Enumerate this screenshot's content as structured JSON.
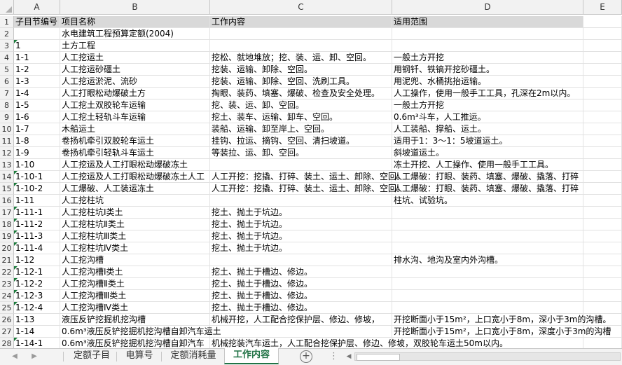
{
  "columns": [
    "A",
    "B",
    "C",
    "D",
    "E"
  ],
  "rows": [
    {
      "n": "1",
      "a": "子目节编号",
      "b": "项目名称",
      "c": "工作内容",
      "d": "适用范围",
      "header": true
    },
    {
      "n": "2",
      "a": "",
      "b": "水电建筑工程预算定额(2004)",
      "c": "",
      "d": ""
    },
    {
      "n": "3",
      "a": "1",
      "b": "土方工程",
      "c": "",
      "d": "",
      "ta": true
    },
    {
      "n": "4",
      "a": "1-1",
      "b": "人工挖运土",
      "c": "挖松、就地堆放；挖、装、运、卸、空回。",
      "d": "一般土方开挖"
    },
    {
      "n": "5",
      "a": "1-2",
      "b": "人工挖运砂礓土",
      "c": "挖装、运输、卸除、空回。",
      "d": "用钢钎、铁镐开挖砂礓土。"
    },
    {
      "n": "6",
      "a": "1-3",
      "b": "人工挖运淤泥、流砂",
      "c": "挖装、运输、卸除、空回、洗刷工具。",
      "d": "用泥兜、水桶挑抬运输。"
    },
    {
      "n": "7",
      "a": "1-4",
      "b": "人工打眼松动爆破土方",
      "c": "掏眼、装药、填塞、爆破、检查及安全处理。",
      "d": "人工操作，使用一般手工工具，孔深在2m以内。"
    },
    {
      "n": "8",
      "a": "1-5",
      "b": "人工挖土双胶轮车运输",
      "c": "挖、装、运、卸、空回。",
      "d": "一般土方开挖"
    },
    {
      "n": "9",
      "a": "1-6",
      "b": "人工挖土轻轨斗车运输",
      "c": "挖土、装车、运输、卸车、空回。",
      "d": "0.6m³斗车，人工推运。"
    },
    {
      "n": "10",
      "a": "1-7",
      "b": "木船运土",
      "c": "装船、运输、卸至岸上、空回。",
      "d": "人工装船、撑船、运土。"
    },
    {
      "n": "11",
      "a": "1-8",
      "b": "卷扬机牵引双胶轮车运土",
      "c": "挂钩、拉运、摘钩、空回、清扫坡道。",
      "d": "适用于1：3～1：5坡道运土。"
    },
    {
      "n": "12",
      "a": "1-9",
      "b": "卷扬机牵引轻轨斗车运土",
      "c": "等装拉、运、卸、空回。",
      "d": "斜坡道运土。"
    },
    {
      "n": "13",
      "a": "1-10",
      "b": "人工挖运及人工打眼松动爆破冻土",
      "c": "",
      "d": "冻土开挖、人工操作、使用一般手工工具。",
      "spillD": true
    },
    {
      "n": "14",
      "a": "1-10-1",
      "b": "人工挖运及人工打眼松动爆破冻土人工",
      "c": "人工开挖：挖撬、打碎、装土、运土、卸除、空回。",
      "d": "人工爆破：打眼、装药、填塞、爆破、撬落、打碎",
      "ta": true,
      "spillC": true,
      "spillD": true
    },
    {
      "n": "15",
      "a": "1-10-2",
      "b": "人工爆破、人工装运冻土",
      "c": "人工开挖：挖撬、打碎、装土、运土、卸除、空回。",
      "d": "人工爆破：打眼、装药、填塞、爆破、撬落、打碎",
      "ta": true,
      "spillC": true,
      "spillD": true
    },
    {
      "n": "16",
      "a": "1-11",
      "b": "人工挖柱坑",
      "c": "",
      "d": "柱坑、试验坑。"
    },
    {
      "n": "17",
      "a": "1-11-1",
      "b": "人工挖柱坑Ⅰ类土",
      "c": "挖土、抛土于坑边。",
      "d": "",
      "ta": true
    },
    {
      "n": "18",
      "a": "1-11-2",
      "b": "人工挖柱坑Ⅱ类土",
      "c": "挖土、抛土于坑边。",
      "d": "",
      "ta": true
    },
    {
      "n": "19",
      "a": "1-11-3",
      "b": "人工挖柱坑Ⅲ类土",
      "c": "挖土、抛土于坑边。",
      "d": "",
      "ta": true
    },
    {
      "n": "20",
      "a": "1-11-4",
      "b": "人工挖柱坑Ⅳ类土",
      "c": "挖土、抛土于坑边。",
      "d": "",
      "ta": true
    },
    {
      "n": "21",
      "a": "1-12",
      "b": "人工挖沟槽",
      "c": "",
      "d": "排水沟、地沟及室内外沟槽。"
    },
    {
      "n": "22",
      "a": "1-12-1",
      "b": "人工挖沟槽Ⅰ类土",
      "c": "挖土、抛土于槽边、修边。",
      "d": "",
      "ta": true
    },
    {
      "n": "23",
      "a": "1-12-2",
      "b": "人工挖沟槽Ⅱ类土",
      "c": "挖土、抛土于槽边、修边。",
      "d": "",
      "ta": true
    },
    {
      "n": "24",
      "a": "1-12-3",
      "b": "人工挖沟槽Ⅲ类土",
      "c": "挖土、抛土于槽边、修边。",
      "d": "",
      "ta": true
    },
    {
      "n": "25",
      "a": "1-12-4",
      "b": "人工挖沟槽Ⅳ类土",
      "c": "挖土、抛土于槽边、修边。",
      "d": "",
      "ta": true
    },
    {
      "n": "26",
      "a": "1-13",
      "b": "液压反铲挖掘机挖沟槽",
      "c": "机械开挖，人工配合挖保护层、修边、修坡，",
      "d": "开挖断面小于15m²，上口宽小于8m，深小于3m的沟槽。",
      "spillD": true
    },
    {
      "n": "27",
      "a": "1-14",
      "b": "0.6m³液压反铲挖掘机挖沟槽自卸汽车运土",
      "c": "",
      "d": "开挖断面小于15m²，上口宽小于8m，深度小于3m的沟槽",
      "spillB": true,
      "spillD": true
    },
    {
      "n": "28",
      "a": "1-14-1",
      "b": "0.6m³液压反铲挖掘机挖沟槽自卸汽车",
      "c": "机械挖装汽车运土，人工配合挖保护层、修边、修坡，双胶轮车运土50m以内。",
      "d": "",
      "ta": true,
      "spillC": true
    }
  ],
  "tabs": [
    "定额子目",
    "电算号",
    "定额消耗量",
    "工作内容"
  ],
  "active_tab": "工作内容",
  "add_sheet": "+",
  "more": "⋮"
}
